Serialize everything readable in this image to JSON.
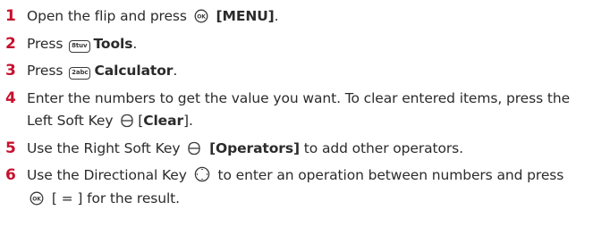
{
  "steps": [
    {
      "num": "1",
      "a": "Open the flip and press",
      "icon": "ok-key-icon",
      "b": "[MENU]",
      "c": "."
    },
    {
      "num": "2",
      "a": "Press",
      "key": "8tuv",
      "b": "Tools",
      "c": "."
    },
    {
      "num": "3",
      "a": "Press",
      "key": "2abc",
      "b": "Calculator",
      "c": "."
    },
    {
      "num": "4",
      "a": "Enter the numbers to get the value you want. To clear entered items, press the Left Soft Key",
      "icon": "left-soft-key-icon",
      "b1": "[",
      "b": "Clear",
      "c": "]."
    },
    {
      "num": "5",
      "a": "Use the Right Soft Key",
      "icon": "right-soft-key-icon",
      "b": "[Operators]",
      "c": "to add other operators."
    },
    {
      "num": "6",
      "a": "Use the Directional Key",
      "icon": "directional-key-icon",
      "b": "to enter an operation between numbers and press",
      "icon2": "ok-key-icon",
      "c": "[ = ] for the result."
    }
  ]
}
